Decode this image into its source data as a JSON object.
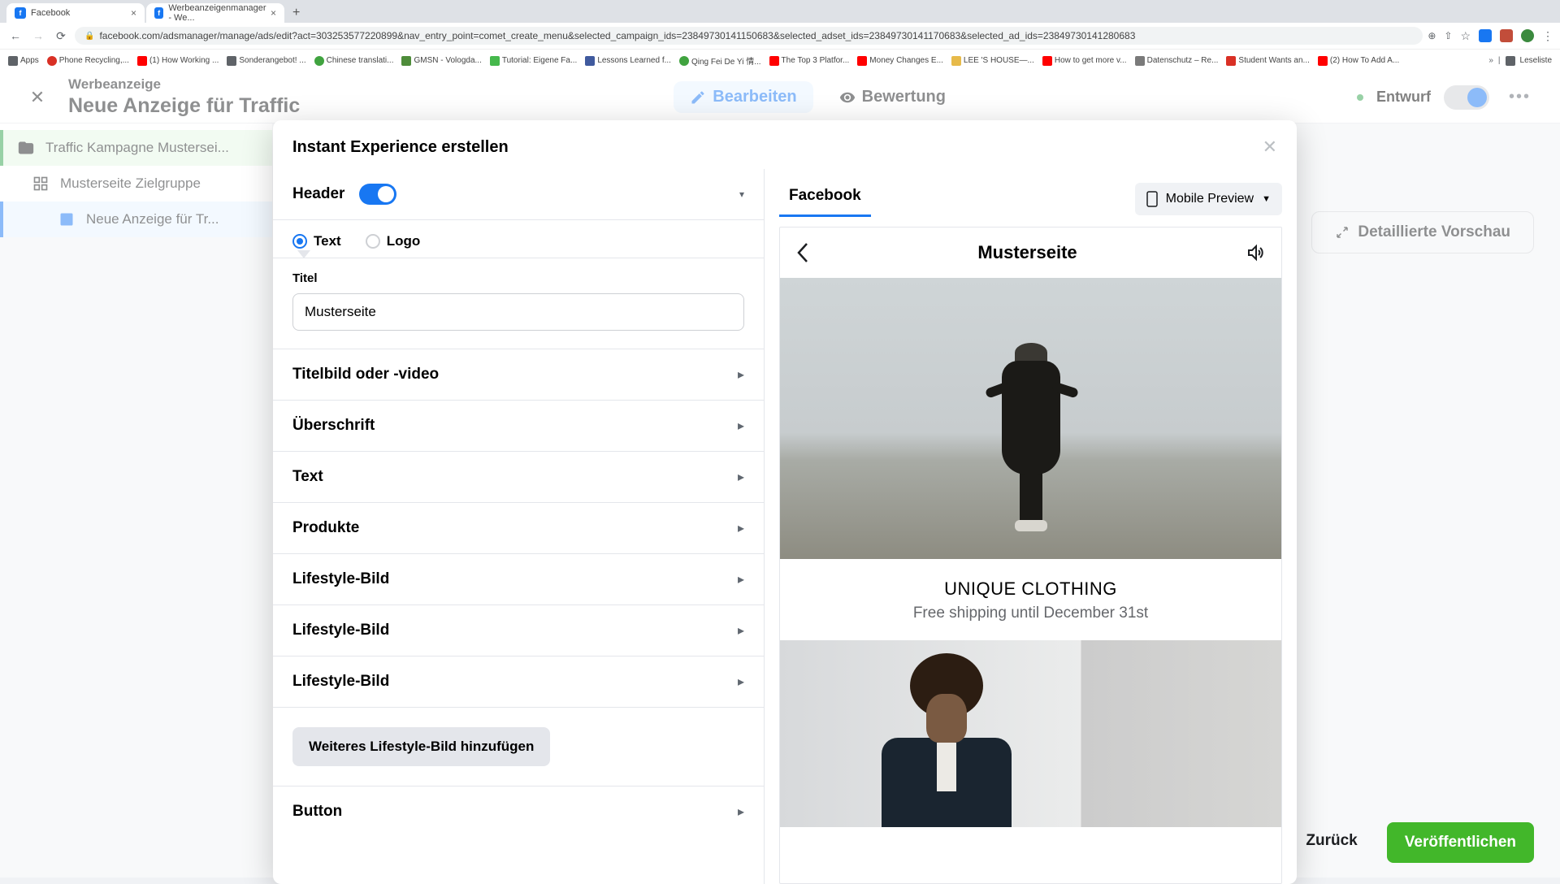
{
  "browser": {
    "tabs": [
      {
        "title": "Facebook",
        "favicon": "f"
      },
      {
        "title": "Werbeanzeigenmanager - We...",
        "favicon": "f"
      }
    ],
    "url": "facebook.com/adsmanager/manage/ads/edit?act=303253577220899&nav_entry_point=comet_create_menu&selected_campaign_ids=23849730141150683&selected_adset_ids=23849730141170683&selected_ad_ids=23849730141280683",
    "bookmarks": [
      "Apps",
      "Phone Recycling,...",
      "(1) How Working ...",
      "Sonderangebot! ...",
      "Chinese translati...",
      "GMSN - Vologda...",
      "Tutorial: Eigene Fa...",
      "Lessons Learned f...",
      "Qing Fei De Yi 情...",
      "The Top 3 Platfor...",
      "Money Changes E...",
      "LEE 'S HOUSE—...",
      "How to get more v...",
      "Datenschutz – Re...",
      "Student Wants an...",
      "(2) How To Add A..."
    ],
    "readlist": "Leseliste"
  },
  "header": {
    "subtitle": "Werbeanzeige",
    "title": "Neue Anzeige für Traffic",
    "tab_edit": "Bearbeiten",
    "tab_review": "Bewertung",
    "draft": "Entwurf"
  },
  "tree": {
    "campaign": "Traffic Kampagne Mustersei...",
    "adset": "Musterseite Zielgruppe",
    "ad": "Neue Anzeige für Tr..."
  },
  "right": {
    "preview_btn": "Detaillierte Vorschau"
  },
  "modal": {
    "title": "Instant Experience erstellen",
    "header_label": "Header",
    "radio_text": "Text",
    "radio_logo": "Logo",
    "title_label": "Titel",
    "title_value": "Musterseite",
    "sections": [
      "Titelbild oder -video",
      "Überschrift",
      "Text",
      "Produkte",
      "Lifestyle-Bild",
      "Lifestyle-Bild",
      "Lifestyle-Bild"
    ],
    "add_lifestyle": "Weiteres Lifestyle-Bild hinzufügen",
    "section_button": "Button",
    "preview_tab": "Facebook",
    "mobile_preview": "Mobile Preview",
    "phone_title": "Musterseite",
    "promo_headline": "UNIQUE CLOTHING",
    "promo_sub": "Free shipping until December 31st"
  },
  "footer": {
    "back": "Zurück",
    "publish": "Veröffentlichen"
  }
}
